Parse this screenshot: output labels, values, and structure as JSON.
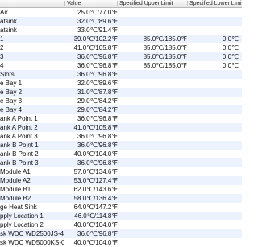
{
  "columns": {
    "name": "",
    "value": "Value",
    "upper": "Specified Upper Limit",
    "lower": "Specified Lower Limit"
  },
  "rows": [
    {
      "name": "Air",
      "value": "25.0℃/77.0℉",
      "upper": "",
      "lower": ""
    },
    {
      "name": "atsink",
      "value": "32.0℃/89.6℉",
      "upper": "",
      "lower": ""
    },
    {
      "name": "atsink",
      "value": "33.0℃/91.4℉",
      "upper": "",
      "lower": ""
    },
    {
      "name": "1",
      "value": "39.0℃/102.2℉",
      "upper": "85.0℃/185.0℉",
      "lower": "0.0℃"
    },
    {
      "name": "2",
      "value": "41.0℃/105.8℉",
      "upper": "85.0℃/185.0℉",
      "lower": "0.0℃"
    },
    {
      "name": "3",
      "value": "36.0℃/96.8℉",
      "upper": "85.0℃/185.0℉",
      "lower": "0.0℃"
    },
    {
      "name": "4",
      "value": "36.0℃/96.8℉",
      "upper": "85.0℃/185.0℉",
      "lower": "0.0℃"
    },
    {
      "name": "Slots",
      "value": "36.0℃/96.8℉",
      "upper": "",
      "lower": ""
    },
    {
      "name": "e Bay 1",
      "value": "32.0℃/89.6℉",
      "upper": "",
      "lower": ""
    },
    {
      "name": "e Bay 2",
      "value": "31.0℃/87.8℉",
      "upper": "",
      "lower": ""
    },
    {
      "name": "e Bay 3",
      "value": "29.0℃/84.2℉",
      "upper": "",
      "lower": ""
    },
    {
      "name": "e Bay 4",
      "value": "29.0℃/84.2℉",
      "upper": "",
      "lower": ""
    },
    {
      "name": "ank A Point 1",
      "value": "36.0℃/96.8℉",
      "upper": "",
      "lower": ""
    },
    {
      "name": "ank A Point 2",
      "value": "41.0℃/105.8℉",
      "upper": "",
      "lower": ""
    },
    {
      "name": "ank A Point 3",
      "value": "36.0℃/96.8℉",
      "upper": "",
      "lower": ""
    },
    {
      "name": "ank B Point 1",
      "value": "36.0℃/96.8℉",
      "upper": "",
      "lower": ""
    },
    {
      "name": "ank B Point 2",
      "value": "40.0℃/104.0℉",
      "upper": "",
      "lower": ""
    },
    {
      "name": "ank B Point 3",
      "value": "36.0℃/96.8℉",
      "upper": "",
      "lower": ""
    },
    {
      "name": "Module A1",
      "value": "57.0℃/134.6℉",
      "upper": "",
      "lower": ""
    },
    {
      "name": "Module A2",
      "value": "53.0℃/127.4℉",
      "upper": "",
      "lower": ""
    },
    {
      "name": "Module B1",
      "value": "62.0℃/143.6℉",
      "upper": "",
      "lower": ""
    },
    {
      "name": "Module B2",
      "value": "58.0℃/136.4℉",
      "upper": "",
      "lower": ""
    },
    {
      "name": "ge Heat Sink",
      "value": "64.0℃/147.2℉",
      "upper": "",
      "lower": ""
    },
    {
      "name": "pply Location 1",
      "value": "46.0℃/114.8℉",
      "upper": "",
      "lower": ""
    },
    {
      "name": "pply Location 2",
      "value": "40.0℃/104.0℉",
      "upper": "",
      "lower": ""
    },
    {
      "name": "sk WDC WD2500JS-41",
      "value": "36.0℃/96.8℉",
      "upper": "",
      "lower": ""
    },
    {
      "name": "sk WDC WD5000KS-0C",
      "value": "40.0℃/104.0℉",
      "upper": "",
      "lower": ""
    }
  ]
}
